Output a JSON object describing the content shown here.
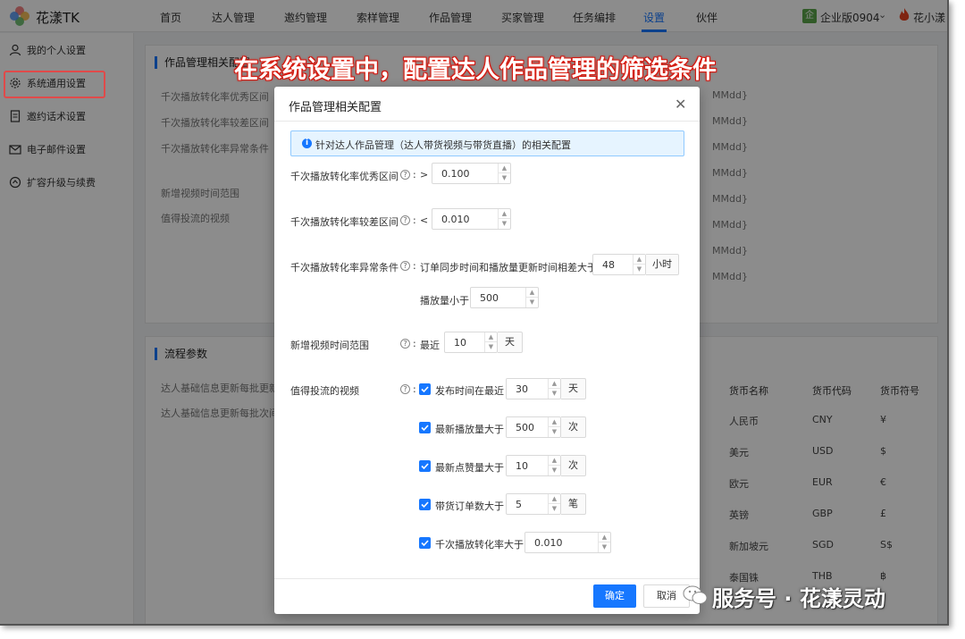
{
  "app": {
    "brand": "花漾TK"
  },
  "nav": {
    "items": [
      "首页",
      "达人管理",
      "邀约管理",
      "索样管理",
      "作品管理",
      "买家管理",
      "任务编排",
      "设置",
      "伙伴"
    ],
    "active": "设置",
    "enterprise_badge": "企",
    "enterprise": "企业版0904",
    "user": "花小漾"
  },
  "sidebar": {
    "items": [
      "我的个人设置",
      "系统通用设置",
      "邀约话术设置",
      "电子邮件设置",
      "扩容升级与续费"
    ],
    "active": "系统通用设置"
  },
  "background": {
    "panel1_title": "作品管理相关配置",
    "panel1_rows": [
      "千次播放转化率优秀区间",
      "千次播放转化率较差区间",
      "千次播放转化率异常条件",
      "新增视频时间范围",
      "值得投流的视频"
    ],
    "mmdd": "MMdd}",
    "panel2_title": "流程参数",
    "panel2_rows": [
      "达人基础信息更新每批更新",
      "达人基础信息更新每批次间"
    ],
    "currency_headers": [
      "货币名称",
      "货币代码",
      "货币符号"
    ],
    "currencies": [
      [
        "人民币",
        "CNY",
        "¥"
      ],
      [
        "美元",
        "USD",
        "$"
      ],
      [
        "欧元",
        "EUR",
        "€"
      ],
      [
        "英镑",
        "GBP",
        "£"
      ],
      [
        "新加坡元",
        "SGD",
        "S$"
      ],
      [
        "泰国铢",
        "THB",
        "฿"
      ]
    ]
  },
  "banner": "在系统设置中，配置达人作品管理的筛选条件",
  "modal": {
    "title": "作品管理相关配置",
    "info": "针对达人作品管理（达人带货视频与带货直播）的相关配置",
    "excellent": {
      "label": "千次播放转化率优秀区间",
      "op": ">",
      "value": "0.100"
    },
    "poor": {
      "label": "千次播放转化率较差区间",
      "op": "<",
      "value": "0.010"
    },
    "abnormal": {
      "label": "千次播放转化率异常条件",
      "cond1": "订单同步时间和播放量更新时间相差大于",
      "value1": "48",
      "unit1": "小时",
      "cond2": "播放量小于",
      "value2": "500"
    },
    "new_video": {
      "label": "新增视频时间范围",
      "prefix": "最近",
      "value": "10",
      "unit": "天"
    },
    "worth": {
      "label": "值得投流的视频",
      "rows": [
        {
          "label": "发布时间在最近",
          "value": "30",
          "unit": "天"
        },
        {
          "label": "最新播放量大于",
          "value": "500",
          "unit": "次"
        },
        {
          "label": "最新点赞量大于",
          "value": "10",
          "unit": "次"
        },
        {
          "label": "带货订单数大于",
          "value": "5",
          "unit": "笔"
        },
        {
          "label": "千次播放转化率大于",
          "value": "0.010",
          "unit": ""
        }
      ]
    },
    "ok": "确定",
    "cancel": "取消"
  },
  "watermark": "服务号 · 花漾灵动"
}
